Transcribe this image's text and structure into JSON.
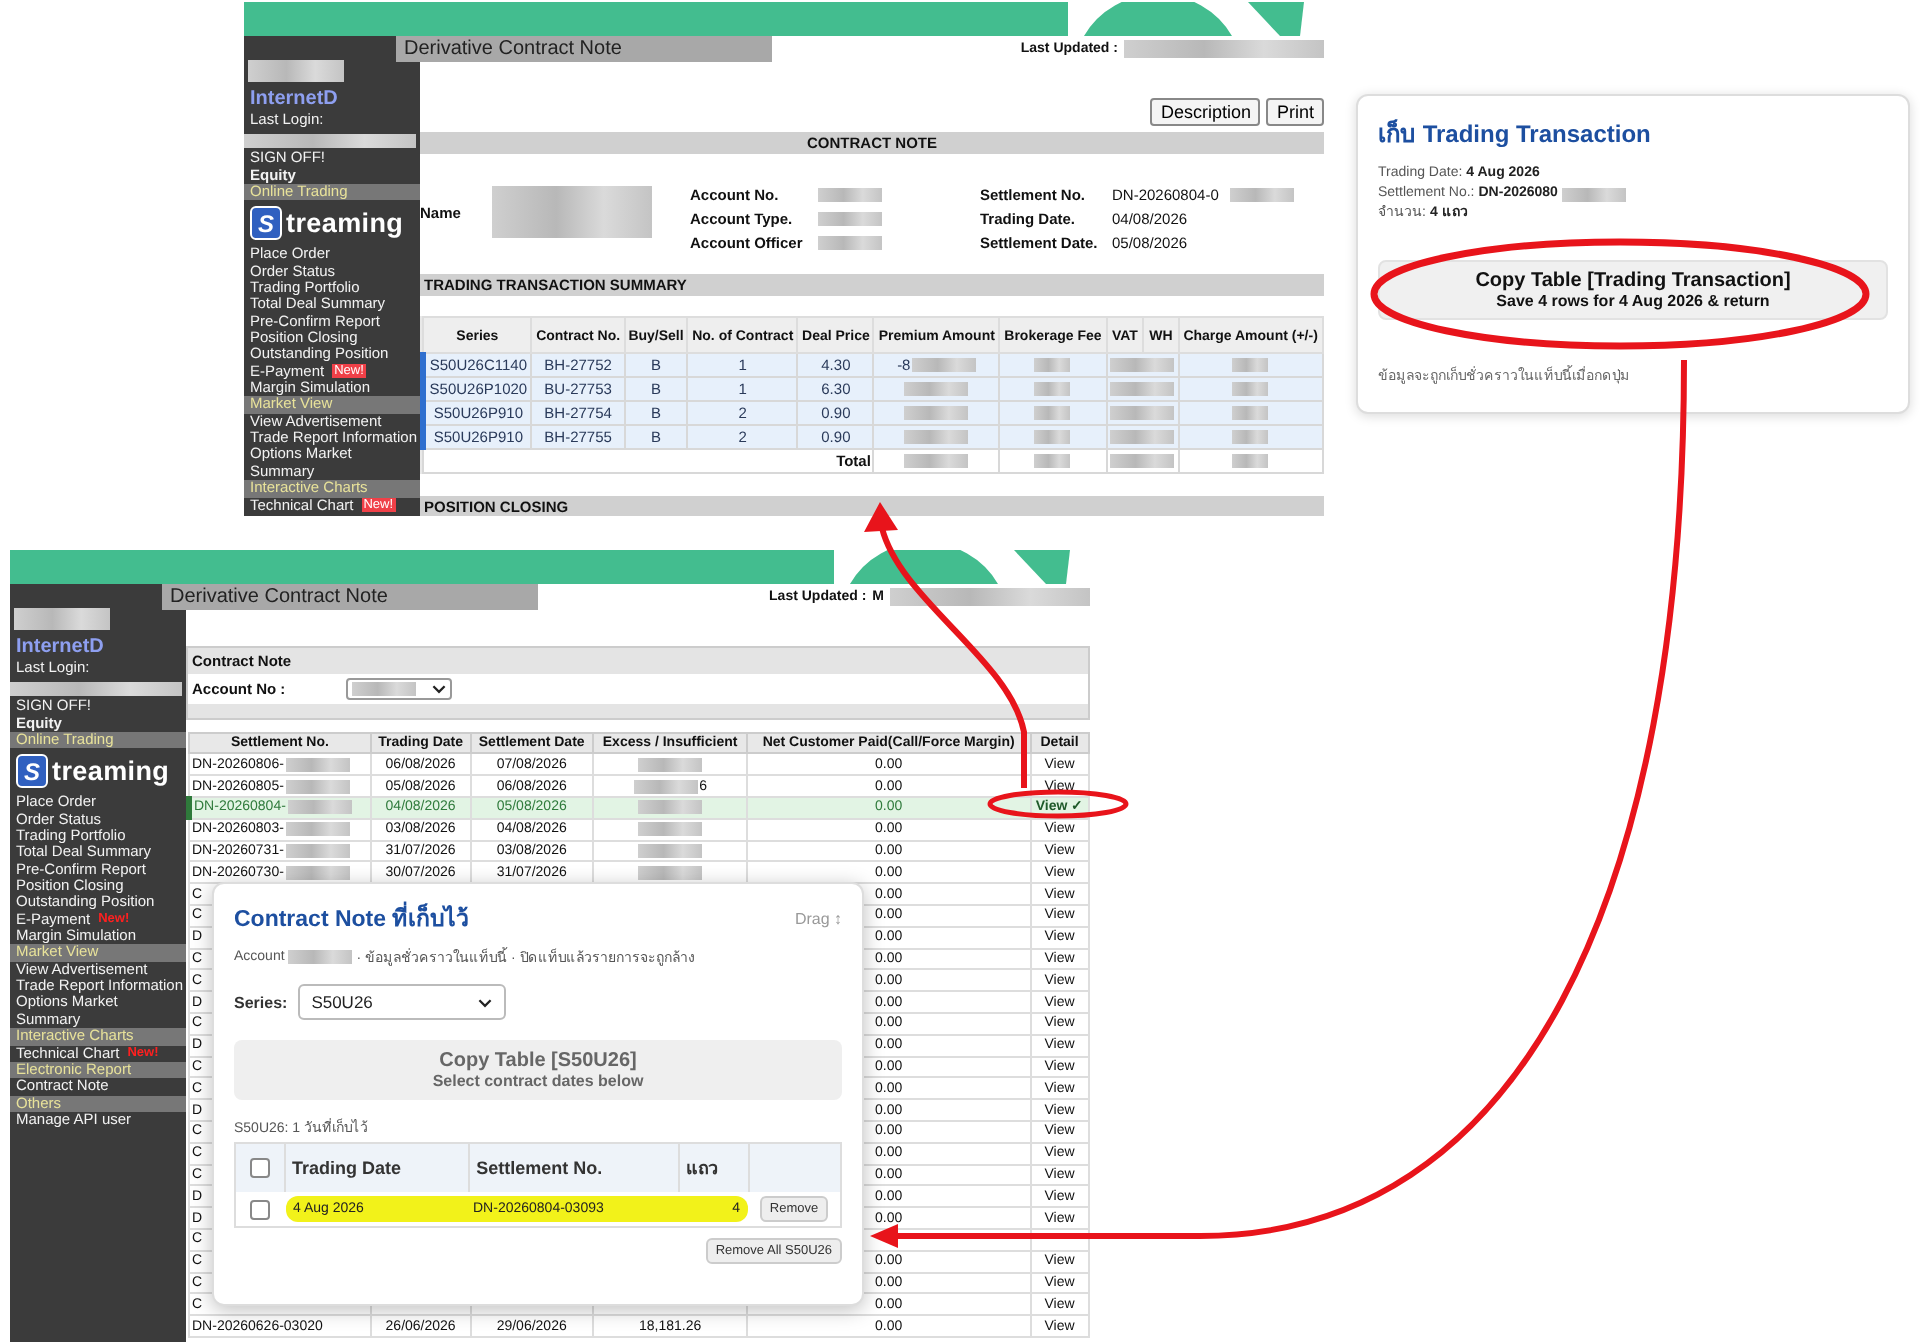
{
  "top_panel": {
    "page_title": "Derivative Contract Note",
    "last_updated_label": "Last Updated :",
    "sidebar": {
      "brand": "InternetD",
      "last_login_label": "Last Login:",
      "items": [
        {
          "kind": "link",
          "label": "SIGN OFF!"
        },
        {
          "kind": "bold",
          "label": "Equity"
        },
        {
          "kind": "section",
          "label": "Online Trading"
        },
        {
          "kind": "logo",
          "glyph": "S",
          "label": "treaming"
        },
        {
          "kind": "link",
          "label": "Place Order"
        },
        {
          "kind": "link",
          "label": "Order Status"
        },
        {
          "kind": "link",
          "label": "Trading Portfolio"
        },
        {
          "kind": "link",
          "label": "Total Deal Summary"
        },
        {
          "kind": "link",
          "label": "Pre-Confirm Report"
        },
        {
          "kind": "link",
          "label": "Position Closing"
        },
        {
          "kind": "link",
          "label": "Outstanding Position"
        },
        {
          "kind": "link",
          "label": "E-Payment",
          "badge": "New!"
        },
        {
          "kind": "link",
          "label": "Margin Simulation"
        },
        {
          "kind": "section",
          "label": "Market View"
        },
        {
          "kind": "link",
          "label": "View Advertisement"
        },
        {
          "kind": "link",
          "label": "Trade Report Information"
        },
        {
          "kind": "link",
          "label": "Options Market"
        },
        {
          "kind": "link",
          "label": "Summary"
        },
        {
          "kind": "section",
          "label": "Interactive Charts"
        },
        {
          "kind": "link",
          "label": "Technical Chart",
          "badge": "New!"
        }
      ]
    },
    "buttons": [
      "Description",
      "Print"
    ],
    "contract_note_heading": "CONTRACT NOTE",
    "field_groups": [
      {
        "fields": [
          {
            "label": "Name",
            "redacted": true
          }
        ]
      },
      {
        "fields": [
          {
            "label": "Account No.",
            "redacted": true
          },
          {
            "label": "Account Type.",
            "redacted": true
          },
          {
            "label": "Account Officer",
            "redacted": true
          }
        ]
      },
      {
        "fields": [
          {
            "label": "Settlement No.",
            "value": "DN-20260804-0",
            "redacted": true
          },
          {
            "label": "Trading Date.",
            "value": "04/08/2026",
            "redacted": false
          },
          {
            "label": "Settlement Date.",
            "value": "05/08/2026",
            "redacted": false
          }
        ]
      }
    ],
    "summary_heading": "TRADING TRANSACTION SUMMARY",
    "summary_table": {
      "columns": [
        "Series",
        "Contract No.",
        "Buy/Sell",
        "No. of Contract",
        "Deal Price",
        "Premium Amount",
        "Brokerage Fee",
        "VAT",
        "WH",
        "Charge Amount (+/-)"
      ],
      "rows": [
        {
          "series": "S50U26C1140",
          "contract_no": "BH-27752",
          "side": "B",
          "contracts": "1",
          "deal_price": "4.30",
          "premium": "-8",
          "selected": true
        },
        {
          "series": "S50U26P1020",
          "contract_no": "BU-27753",
          "side": "B",
          "contracts": "1",
          "deal_price": "6.30",
          "selected": true
        },
        {
          "series": "S50U26P910",
          "contract_no": "BH-27754",
          "side": "B",
          "contracts": "2",
          "deal_price": "0.90",
          "selected": true
        },
        {
          "series": "S50U26P910",
          "contract_no": "BH-27755",
          "side": "B",
          "contracts": "2",
          "deal_price": "0.90",
          "selected": true
        }
      ],
      "total_label": "Total"
    },
    "position_closing_heading": "POSITION CLOSING"
  },
  "transaction_card": {
    "title": "เก็บ Trading Transaction",
    "lines": [
      {
        "label": "Trading Date:",
        "value": "4 Aug 2026",
        "redacted": false
      },
      {
        "label": "Settlement No.:",
        "value": "DN-2026080",
        "redacted": true
      },
      {
        "label": "จำนวน:",
        "value": "4 แถว",
        "redacted": false
      }
    ],
    "button": {
      "title": "Copy Table [Trading Transaction]",
      "subtitle": "Save 4 rows for 4 Aug 2026 & return"
    },
    "note": "ข้อมูลจะถูกเก็บชั่วคราวในแท็บนี้เมื่อกดปุ่ม"
  },
  "bottom_panel": {
    "page_title": "Derivative Contract Note",
    "last_updated_label": "Last Updated :",
    "last_updated_value": "M",
    "sidebar": {
      "brand": "InternetD",
      "last_login_label": "Last Login:",
      "items": [
        {
          "kind": "link",
          "label": "SIGN OFF!"
        },
        {
          "kind": "bold",
          "label": "Equity"
        },
        {
          "kind": "section",
          "label": "Online Trading"
        },
        {
          "kind": "logo",
          "glyph": "S",
          "label": "treaming"
        },
        {
          "kind": "link",
          "label": "Place Order"
        },
        {
          "kind": "link",
          "label": "Order Status"
        },
        {
          "kind": "link",
          "label": "Trading Portfolio"
        },
        {
          "kind": "link",
          "label": "Total Deal Summary"
        },
        {
          "kind": "link",
          "label": "Pre-Confirm Report"
        },
        {
          "kind": "link",
          "label": "Position Closing"
        },
        {
          "kind": "link",
          "label": "Outstanding Position"
        },
        {
          "kind": "link",
          "label": "E-Payment",
          "badge": "New!"
        },
        {
          "kind": "link",
          "label": "Margin Simulation"
        },
        {
          "kind": "section",
          "label": "Market View"
        },
        {
          "kind": "link",
          "label": "View Advertisement"
        },
        {
          "kind": "link",
          "label": "Trade Report Information"
        },
        {
          "kind": "link",
          "label": "Options Market"
        },
        {
          "kind": "link",
          "label": "Summary"
        },
        {
          "kind": "section",
          "label": "Interactive Charts"
        },
        {
          "kind": "link",
          "label": "Technical Chart",
          "badge": "New!"
        },
        {
          "kind": "section",
          "label": "Electronic Report"
        },
        {
          "kind": "link",
          "label": "Contract Note"
        },
        {
          "kind": "section",
          "label": "Others"
        },
        {
          "kind": "link",
          "label": "Manage API user"
        }
      ]
    },
    "filter_heading": "Contract Note",
    "account_label": "Account No :",
    "table": {
      "columns": [
        "Settlement No.",
        "Trading Date",
        "Settlement Date",
        "Excess / Insufficient",
        "Net Customer Paid(Call/Force Margin)",
        "Detail"
      ],
      "rows": [
        {
          "settlement_no": "DN-20260806-",
          "trading_date": "06/08/2026",
          "settlement_date": "07/08/2026",
          "net": "0.00",
          "detail": "View",
          "redacted": true,
          "selected": false
        },
        {
          "settlement_no": "DN-20260805-",
          "trading_date": "05/08/2026",
          "settlement_date": "06/08/2026",
          "excess": "6",
          "net": "0.00",
          "detail": "View",
          "redacted": true,
          "selected": false
        },
        {
          "settlement_no": "DN-20260804-",
          "trading_date": "04/08/2026",
          "settlement_date": "05/08/2026",
          "net": "0.00",
          "detail": "View ✓",
          "redacted": true,
          "selected": true
        },
        {
          "settlement_no": "DN-20260803-",
          "trading_date": "03/08/2026",
          "settlement_date": "04/08/2026",
          "net": "0.00",
          "detail": "View",
          "redacted": true,
          "selected": false
        },
        {
          "settlement_no": "DN-20260731-",
          "trading_date": "31/07/2026",
          "settlement_date": "03/08/2026",
          "net": "0.00",
          "detail": "View",
          "redacted": true,
          "selected": false
        },
        {
          "settlement_no": "DN-20260730-",
          "trading_date": "30/07/2026",
          "settlement_date": "31/07/2026",
          "net": "0.00",
          "detail": "View",
          "redacted": true,
          "selected": false
        },
        {
          "settlement_no": "C",
          "net": "0.00",
          "detail": "View",
          "redacted": false,
          "selected": false
        },
        {
          "settlement_no": "C",
          "net": "0.00",
          "detail": "View",
          "redacted": false,
          "selected": false
        },
        {
          "settlement_no": "D",
          "net": "0.00",
          "detail": "View",
          "redacted": false,
          "selected": false
        },
        {
          "settlement_no": "C",
          "net": "0.00",
          "detail": "View",
          "redacted": false,
          "selected": false
        },
        {
          "settlement_no": "C",
          "net": "0.00",
          "detail": "View",
          "redacted": false,
          "selected": false
        },
        {
          "settlement_no": "D",
          "net": "0.00",
          "detail": "View",
          "redacted": false,
          "selected": false
        },
        {
          "settlement_no": "C",
          "net": "0.00",
          "detail": "View",
          "redacted": false,
          "selected": false
        },
        {
          "settlement_no": "D",
          "net": "0.00",
          "detail": "View",
          "redacted": false,
          "selected": false
        },
        {
          "settlement_no": "C",
          "net": "0.00",
          "detail": "View",
          "redacted": false,
          "selected": false
        },
        {
          "settlement_no": "C",
          "net": "0.00",
          "detail": "View",
          "redacted": false,
          "selected": false
        },
        {
          "settlement_no": "D",
          "net": "0.00",
          "detail": "View",
          "redacted": false,
          "selected": false
        },
        {
          "settlement_no": "C",
          "net": "0.00",
          "detail": "View",
          "redacted": false,
          "selected": false
        },
        {
          "settlement_no": "C",
          "net": "0.00",
          "detail": "View",
          "redacted": false,
          "selected": false
        },
        {
          "settlement_no": "C",
          "net": "0.00",
          "detail": "View",
          "redacted": false,
          "selected": false
        },
        {
          "settlement_no": "D",
          "net": "0.00",
          "detail": "View",
          "redacted": false,
          "selected": false
        },
        {
          "settlement_no": "D",
          "net": "0.00",
          "detail": "View",
          "redacted": false,
          "selected": false
        },
        {
          "settlement_no": "C",
          "redacted": false,
          "selected": false
        },
        {
          "settlement_no": "C",
          "net": "0.00",
          "detail": "View",
          "redacted": false,
          "selected": false
        },
        {
          "settlement_no": "C",
          "net": "0.00",
          "detail": "View",
          "redacted": false,
          "selected": false
        },
        {
          "settlement_no": "C",
          "net": "0.00",
          "detail": "View",
          "redacted": false,
          "selected": false
        },
        {
          "settlement_no": "DN-20260626-03020",
          "trading_date": "26/06/2026",
          "settlement_date": "29/06/2026",
          "excess": "18,181.26",
          "net": "0.00",
          "detail": "View",
          "redacted": false,
          "selected": false
        }
      ]
    }
  },
  "saved_popup": {
    "title": "Contract Note ที่เก็บไว้",
    "drag_label": "Drag ↕",
    "account_label": "Account",
    "subtitle": "· ข้อมูลชั่วคราวในแท็บนี้ · ปิดแท็บแล้วรายการจะถูกล้าง",
    "series_label": "Series:",
    "series_value": "S50U26",
    "copy_button": {
      "title": "Copy Table [S50U26]",
      "subtitle": "Select contract dates below",
      "disabled": true
    },
    "count_label": "S50U26: 1 วันที่เก็บไว้",
    "columns": [
      "Trading Date",
      "Settlement No.",
      "แถว"
    ],
    "header_checked": false,
    "rows": [
      {
        "trading_date": "4 Aug 2026",
        "settlement_no": "DN-20260804-03093",
        "rows": "4",
        "checked": false,
        "selected": true,
        "action": "Remove"
      }
    ],
    "remove_all": "Remove All S50U26"
  }
}
